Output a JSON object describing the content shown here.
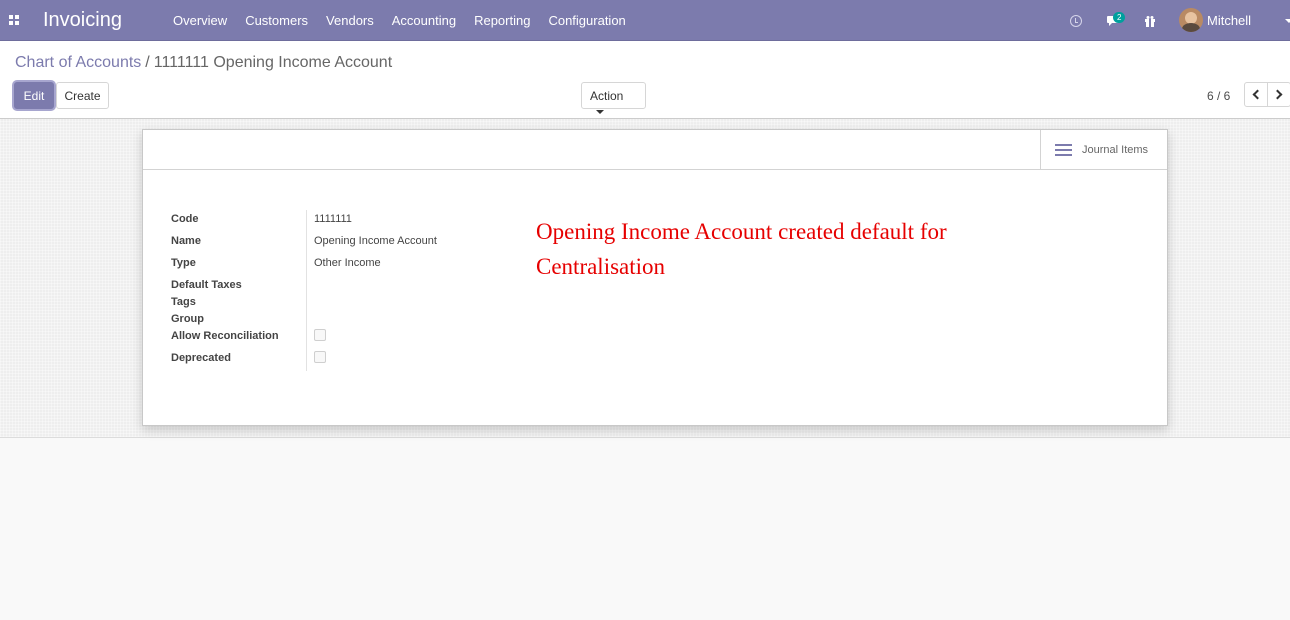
{
  "navbar": {
    "app_name": "Invoicing",
    "menu": [
      "Overview",
      "Customers",
      "Vendors",
      "Accounting",
      "Reporting",
      "Configuration"
    ],
    "message_badge": "2",
    "user_name": "Mitchell Admin",
    "icons": [
      "apps-icon",
      "clock-icon",
      "chat-icon",
      "gift-icon",
      "avatar"
    ],
    "colors": {
      "brand": "#7c7bad",
      "badge": "#00a09d"
    }
  },
  "breadcrumb": {
    "parent": "Chart of Accounts",
    "separator": "/",
    "current": "1111111 Opening Income Account"
  },
  "buttons": {
    "edit": "Edit",
    "create": "Create",
    "action": "Action"
  },
  "pager": {
    "value": "6 / 6"
  },
  "smart_button": {
    "label": "Journal Items"
  },
  "form": {
    "labels": {
      "code": "Code",
      "name": "Name",
      "type": "Type",
      "default_taxes": "Default Taxes",
      "tags": "Tags",
      "group": "Group",
      "allow_reconciliation": "Allow Reconciliation",
      "deprecated": "Deprecated"
    },
    "values": {
      "code": "1111111",
      "name": "Opening Income Account",
      "type": "Other Income",
      "default_taxes": "",
      "tags": "",
      "group": "",
      "allow_reconciliation": false,
      "deprecated": false
    }
  },
  "annotation": {
    "text": "Opening Income Account created default for Centralisation",
    "color": "#e60000"
  }
}
